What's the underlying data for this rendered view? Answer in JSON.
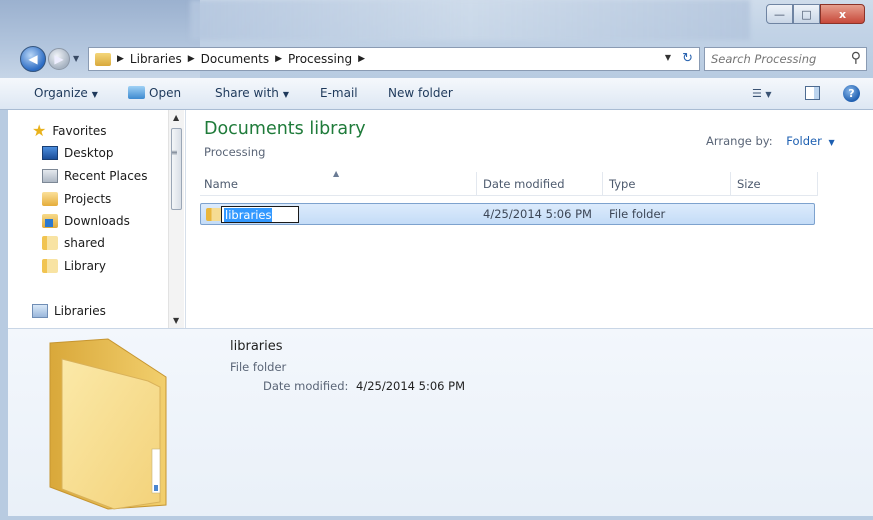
{
  "window": {
    "controls": {
      "minimize": "—",
      "maximize": "□",
      "close": "x"
    }
  },
  "address": {
    "crumbs": [
      "Libraries",
      "Documents",
      "Processing"
    ],
    "search_placeholder": "Search Processing"
  },
  "toolbar": {
    "organize": "Organize",
    "open": "Open",
    "share_with": "Share with",
    "email": "E-mail",
    "new_folder": "New folder"
  },
  "navigation": {
    "favorites": "Favorites",
    "items": [
      "Desktop",
      "Recent Places",
      "Projects",
      "Downloads",
      "shared",
      "Library"
    ],
    "libraries": "Libraries"
  },
  "content": {
    "title": "Documents library",
    "subtitle": "Processing",
    "arrange_label": "Arrange by:",
    "arrange_value": "Folder",
    "columns": [
      "Name",
      "Date modified",
      "Type",
      "Size"
    ],
    "rows": [
      {
        "name": "libraries",
        "date_modified": "4/25/2014 5:06 PM",
        "type": "File folder",
        "size": ""
      }
    ]
  },
  "details": {
    "name": "libraries",
    "type": "File folder",
    "date_label": "Date modified:",
    "date_value": "4/25/2014 5:06 PM"
  },
  "colors": {
    "library_title": "#1f7b3a",
    "selection": "#3399ff",
    "link_blue": "#1d5fb1"
  }
}
